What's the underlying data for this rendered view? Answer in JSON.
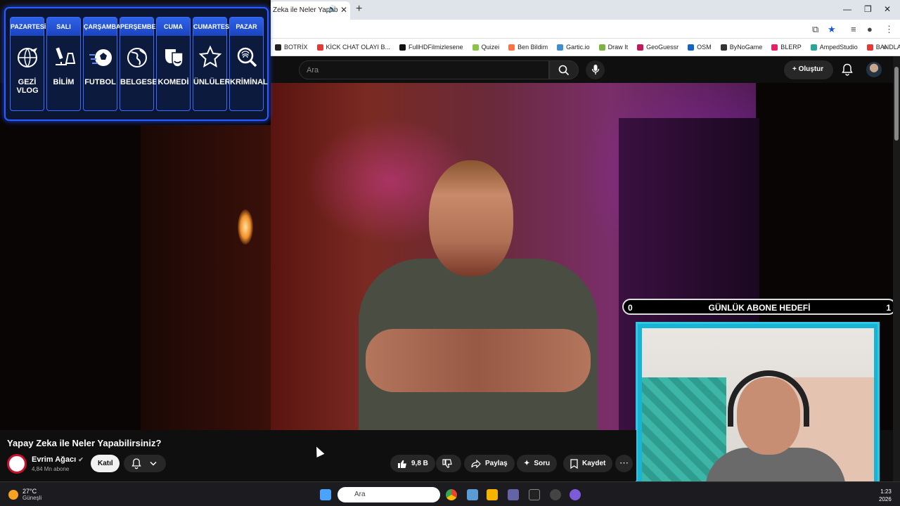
{
  "browser": {
    "tab_title": "Zeka ile Neler Yapab",
    "window_controls": {
      "minimize": "—",
      "restore": "❐",
      "close": "✕"
    },
    "bookmarks": [
      {
        "label": "BOTRİX",
        "color": "#222222"
      },
      {
        "label": "KİCK CHAT OLAYI B...",
        "color": "#e53935"
      },
      {
        "label": "FullHDFilmizlesene",
        "color": "#111111"
      },
      {
        "label": "Quizei",
        "color": "#8bc34a"
      },
      {
        "label": "Ben Bildim",
        "color": "#ff7043"
      },
      {
        "label": "Gartic.io",
        "color": "#3f8fd0"
      },
      {
        "label": "Draw It",
        "color": "#7cb342"
      },
      {
        "label": "GeoGuessr",
        "color": "#c2185b"
      },
      {
        "label": "OSM",
        "color": "#1565c0"
      },
      {
        "label": "ByNoGame",
        "color": "#333333"
      },
      {
        "label": "BLERP",
        "color": "#e91e63"
      },
      {
        "label": "AmpedStudio",
        "color": "#26a69a"
      },
      {
        "label": "BANDLAB",
        "color": "#e53935"
      }
    ]
  },
  "youtube": {
    "search_placeholder": "Ara",
    "create_label": "Oluştur"
  },
  "schedule": {
    "days": [
      {
        "day": "PAZARTESİ",
        "label": "GEZİ VLOG",
        "icon": "globe-plane-icon"
      },
      {
        "day": "SALI",
        "label": "BİLİM",
        "icon": "microscope-icon"
      },
      {
        "day": "ÇARŞAMBA",
        "label": "FUTBOL",
        "icon": "soccer-ball-icon"
      },
      {
        "day": "PERŞEMBE",
        "label": "BELGESEL",
        "icon": "earth-icon"
      },
      {
        "day": "CUMA",
        "label": "KOMEDİ",
        "icon": "theater-masks-icon"
      },
      {
        "day": "CUMARTESİ",
        "label": "ÜNLÜLER",
        "icon": "star-icon"
      },
      {
        "day": "PAZAR",
        "label": "KRİMİNAL",
        "icon": "fingerprint-magnifier-icon"
      }
    ]
  },
  "goal": {
    "left": "0",
    "title": "GÜNLÜK ABONE HEDEFİ",
    "right": "1"
  },
  "video": {
    "title": "Yapay Zeka ile Neler Yapabilirsiniz?",
    "channel": "Evrim Ağacı",
    "subscribers": "4,84 Mn abone",
    "join_label": "Katıl",
    "likes": "9,8 B",
    "share_label": "Paylaş",
    "ask_label": "Soru",
    "save_label": "Kaydet"
  },
  "taskbar": {
    "temperature": "27°C",
    "weather": "Güneşli",
    "search_placeholder": "Ara",
    "time": "1:23",
    "date": "2026"
  }
}
